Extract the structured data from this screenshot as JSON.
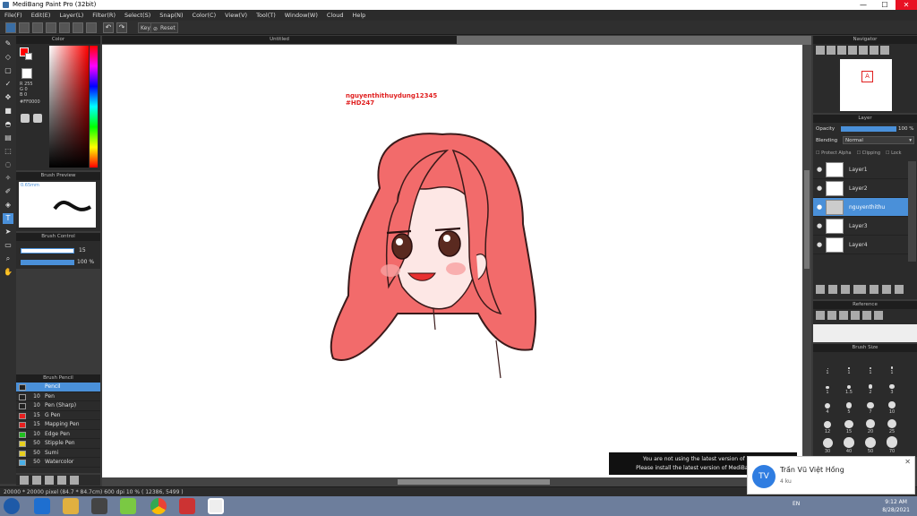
{
  "window": {
    "title": "MediBang Paint Pro (32bit)",
    "minimize": "—",
    "maximize": "☐",
    "close": "✕"
  },
  "menu": [
    "File(F)",
    "Edit(E)",
    "Layer(L)",
    "Filter(R)",
    "Select(S)",
    "Snap(N)",
    "Color(C)",
    "View(V)",
    "Tool(T)",
    "Window(W)",
    "Cloud",
    "Help"
  ],
  "toolbar": {
    "key_label": "Key",
    "reset_label": "Reset"
  },
  "canvas": {
    "tab_title": "Untitled",
    "watermark_line1": "nguyenthithuydung12345",
    "watermark_line2": "#HD247"
  },
  "color_panel": {
    "title": "Color",
    "rgb": [
      "R 255",
      "G 0",
      "B 0"
    ],
    "hex": "#FF0000"
  },
  "brush_preview": {
    "title": "Brush Preview",
    "size": "0.65mm"
  },
  "brush_control": {
    "title": "Brush Control",
    "size_value": "15",
    "opacity_value": "100 %"
  },
  "brush_list": {
    "title": "Brush Pencil",
    "items": [
      {
        "size": "",
        "name": "Pencil",
        "color": "#222222"
      },
      {
        "size": "10",
        "name": "Pen",
        "color": "#222222"
      },
      {
        "size": "10",
        "name": "Pen (Sharp)",
        "color": "#222222"
      },
      {
        "size": "15",
        "name": "G Pen",
        "color": "#e82020"
      },
      {
        "size": "15",
        "name": "Mapping Pen",
        "color": "#e82020"
      },
      {
        "size": "10",
        "name": "Edge Pen",
        "color": "#20c020"
      },
      {
        "size": "50",
        "name": "Stipple Pen",
        "color": "#e8d020"
      },
      {
        "size": "50",
        "name": "Sumi",
        "color": "#e8d020"
      },
      {
        "size": "50",
        "name": "Watercolor",
        "color": "#4ab0e8"
      }
    ]
  },
  "navigator": {
    "title": "Navigator"
  },
  "layer_panel": {
    "title": "Layer",
    "opacity_label": "Opacity",
    "opacity_value": "100 %",
    "blending_label": "Blending",
    "blending_value": "Normal",
    "protect_alpha": "Protect Alpha",
    "clipping": "Clipping",
    "lock": "Lock",
    "layers": [
      {
        "name": "Layer1",
        "selected": false
      },
      {
        "name": "Layer2",
        "selected": false
      },
      {
        "name": "nguyenthithu",
        "selected": true
      },
      {
        "name": "Layer3",
        "selected": false
      },
      {
        "name": "Layer4",
        "selected": false
      }
    ]
  },
  "reference": {
    "title": "Reference"
  },
  "brush_size": {
    "title": "Brush Size",
    "sizes": [
      "1",
      "1",
      "1",
      "1",
      "1",
      "1.5",
      "2",
      "3",
      "4",
      "5",
      "7",
      "10",
      "12",
      "15",
      "20",
      "25",
      "30",
      "40",
      "50",
      "70",
      "",
      "",
      "",
      ""
    ]
  },
  "status": {
    "text": "20000 * 20000 pixel  (84.7 * 84.7cm)  600 dpi  10 %  ( 12386, 5499 )"
  },
  "toast": {
    "line1": "You are not using the latest version of MediB",
    "line2": "Please install the latest version of MediBang Paint"
  },
  "notification": {
    "initials": "TV",
    "name": "Trần Vũ Việt Hồng",
    "sub": "4 ku"
  },
  "taskbar": {
    "time": "9:12 AM",
    "date": "8/28/2021",
    "lang": "EN"
  },
  "colors": {
    "hair": "#f26b6b",
    "accent": "#4a90d9",
    "watermark": "#e02020"
  }
}
